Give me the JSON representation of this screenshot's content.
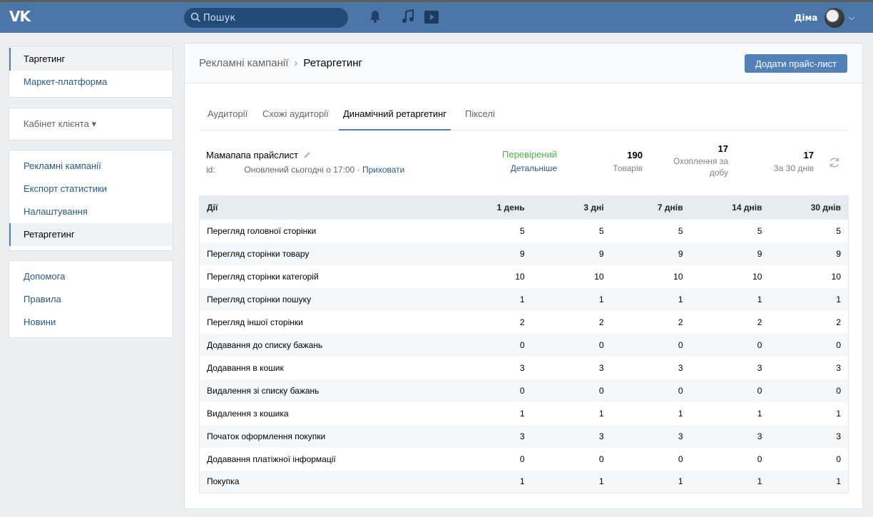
{
  "header": {
    "logo_text": "VK",
    "search_placeholder": "Пошук",
    "user_name": "Діма",
    "caret": "⌵"
  },
  "sidebar": {
    "group1": [
      {
        "label": "Таргетинг",
        "active": true
      },
      {
        "label": "Маркет-платформа",
        "active": false
      }
    ],
    "group2": [
      {
        "label": "Кабінет клієнта ▾"
      }
    ],
    "group3": [
      {
        "label": "Рекламні кампанії"
      },
      {
        "label": "Експорт статистики"
      },
      {
        "label": "Налаштування"
      },
      {
        "label": "Ретаргетинг"
      }
    ],
    "group4": [
      {
        "label": "Допомога"
      },
      {
        "label": "Правила"
      },
      {
        "label": "Новини"
      }
    ]
  },
  "breadcrumb": {
    "parent": "Рекламні кампанії",
    "separator": "›",
    "current": "Ретаргетинг"
  },
  "toolbar": {
    "add_pricelist_label": "Додати прайс-лист"
  },
  "tabs": [
    {
      "label": "Аудиторії"
    },
    {
      "label": "Схожі аудиторії"
    },
    {
      "label": "Динамічний ретаргетинг"
    },
    {
      "label": "Пікселі"
    }
  ],
  "pricelist": {
    "name": "Мамапапа прайслист",
    "id_label": "id:",
    "updated": "Оновлений сьогодні о 17:00 ·",
    "hide_link": "Приховати",
    "status": "Перевірений",
    "details_link": "Детальніше",
    "goods_count": "190",
    "goods_label": "Товарів",
    "reach_count": "17",
    "reach_label_1": "Охоплення за",
    "reach_label_2": "добу",
    "period_count": "17",
    "period_label": "За 30 днів"
  },
  "table": {
    "headers": [
      "Дії",
      "1 день",
      "3 дні",
      "7 днів",
      "14 днів",
      "30 днів"
    ],
    "rows": [
      [
        "Перегляд головної сторінки",
        "5",
        "5",
        "5",
        "5",
        "5"
      ],
      [
        "Перегляд сторінки товару",
        "9",
        "9",
        "9",
        "9",
        "9"
      ],
      [
        "Перегляд сторінки категорій",
        "10",
        "10",
        "10",
        "10",
        "10"
      ],
      [
        "Перегляд сторінки пошуку",
        "1",
        "1",
        "1",
        "1",
        "1"
      ],
      [
        "Перегляд іншої сторінки",
        "2",
        "2",
        "2",
        "2",
        "2"
      ],
      [
        "Додавання до списку бажань",
        "0",
        "0",
        "0",
        "0",
        "0"
      ],
      [
        "Додавання в кошик",
        "3",
        "3",
        "3",
        "3",
        "3"
      ],
      [
        "Видалення зі списку бажань",
        "0",
        "0",
        "0",
        "0",
        "0"
      ],
      [
        "Видалення з кошика",
        "1",
        "1",
        "1",
        "1",
        "1"
      ],
      [
        "Початок оформлення покупки",
        "3",
        "3",
        "3",
        "3",
        "3"
      ],
      [
        "Додавання платіжної інформації",
        "0",
        "0",
        "0",
        "0",
        "0"
      ],
      [
        "Покупка",
        "1",
        "1",
        "1",
        "1",
        "1"
      ]
    ]
  },
  "colors": {
    "header_bg": "#4a76a8",
    "accent": "#5181b8",
    "link": "#2a5885",
    "verified": "#4bb34b"
  }
}
